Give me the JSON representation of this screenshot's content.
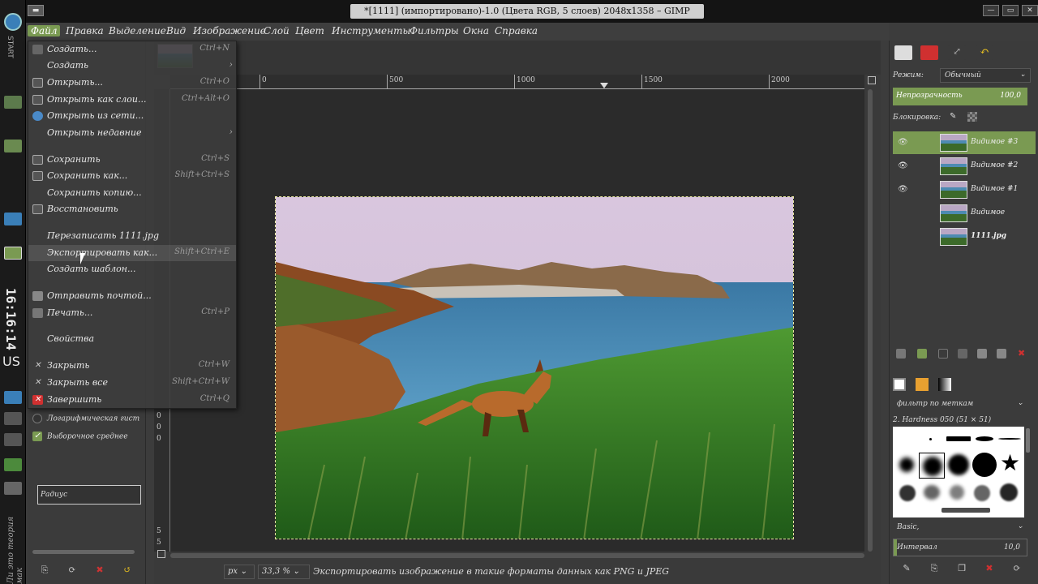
{
  "window": {
    "title": "*[1111] (импортировано)-1.0 (Цвета RGB, 5 слоев) 2048x1358 – GIMP"
  },
  "dock": {
    "start_label": "START",
    "clock": "16:16:14",
    "lang": "US",
    "bottom_text": "Ли это теория мак"
  },
  "menubar": [
    "Файл",
    "Правка",
    "Выделение",
    "Вид",
    "Изображение",
    "Слой",
    "Цвет",
    "Инструменты",
    "Фильтры",
    "Окна",
    "Справка"
  ],
  "file_menu": [
    {
      "label": "Создать...",
      "shortcut": "Ctrl+N"
    },
    {
      "label": "Создать",
      "submenu": true
    },
    {
      "label": "Открыть...",
      "shortcut": "Ctrl+O"
    },
    {
      "label": "Открыть как слои...",
      "shortcut": "Ctrl+Alt+O"
    },
    {
      "label": "Открыть из сети..."
    },
    {
      "label": "Открыть недавние",
      "submenu": true
    },
    {
      "label": "Сохранить",
      "shortcut": "Ctrl+S"
    },
    {
      "label": "Сохранить как...",
      "shortcut": "Shift+Ctrl+S"
    },
    {
      "label": "Сохранить копию..."
    },
    {
      "label": "Восстановить"
    },
    {
      "label": "Перезаписать 1111.jpg"
    },
    {
      "label": "Экспортировать как...",
      "shortcut": "Shift+Ctrl+E"
    },
    {
      "label": "Создать шаблон..."
    },
    {
      "label": "Отправить почтой..."
    },
    {
      "label": "Печать...",
      "shortcut": "Ctrl+P"
    },
    {
      "label": "Свойства"
    },
    {
      "label": "Закрыть",
      "shortcut": "Ctrl+W"
    },
    {
      "label": "Закрыть все",
      "shortcut": "Shift+Ctrl+W"
    },
    {
      "label": "Завершить",
      "shortcut": "Ctrl+Q"
    }
  ],
  "toolbox": {
    "log_histogram": "Логарифмическая гист",
    "sample_average": "Выборочное среднее",
    "radius": "Радиус"
  },
  "ruler": {
    "h_labels": [
      "0",
      "500",
      "1000",
      "1500",
      "2000"
    ],
    "v_labels": [
      "0",
      "0",
      "0",
      "5",
      "5"
    ]
  },
  "status": {
    "unit": "px",
    "zoom": "33,3 %",
    "message": "Экспортировать изображение в такие форматы данных как PNG и JPEG"
  },
  "layers_panel": {
    "mode_label": "Режим:",
    "mode_value": "Обычный",
    "opacity_label": "Непрозрачность",
    "opacity_value": "100,0",
    "lock_label": "Блокировка:",
    "layers": [
      {
        "name": "Видимое #3",
        "visible": true,
        "selected": true
      },
      {
        "name": "Видимое #2",
        "visible": true,
        "selected": false
      },
      {
        "name": "Видимое #1",
        "visible": true,
        "selected": false
      },
      {
        "name": "Видимое",
        "visible": false,
        "selected": false
      },
      {
        "name": "1111.jpg",
        "visible": false,
        "selected": false
      }
    ]
  },
  "brushes_panel": {
    "filter_label": "фильтр по меткам",
    "brush_name": "2. Hardness 050 (51 × 51)",
    "preset": "Basic,",
    "interval_label": "Интервал",
    "interval_value": "10,0"
  }
}
